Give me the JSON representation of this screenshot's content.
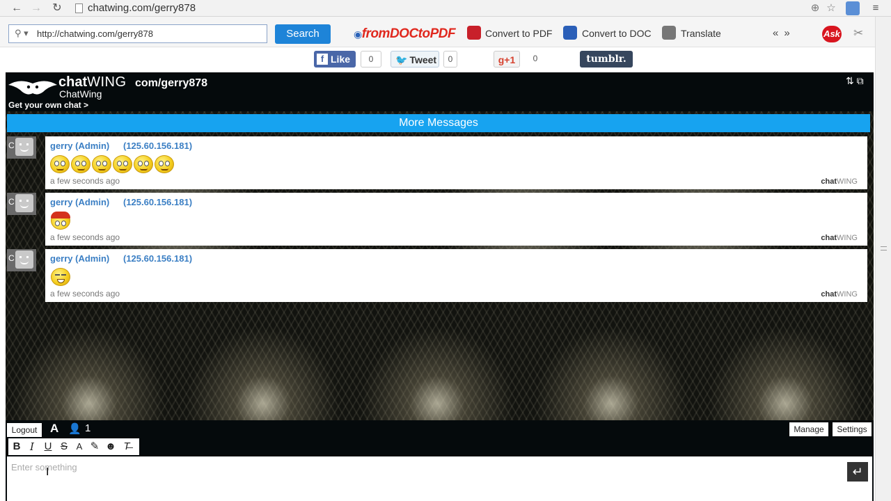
{
  "browser": {
    "url": "chatwing.com/gerry878",
    "back_icon": "←",
    "forward_icon": "→",
    "reload_icon": "↻",
    "zoom_icon": "⊕",
    "star_icon": "☆",
    "menu_icon": "≡"
  },
  "toolbar": {
    "search_value": "http://chatwing.com/gerry878",
    "search_button": "Search",
    "fromdoc_logo": "fromDOCtoPDF",
    "convert_pdf": "Convert to PDF",
    "convert_doc": "Convert to DOC",
    "translate": "Translate",
    "ask_logo": "Ask",
    "arrows": "«»"
  },
  "social": {
    "like_label": "Like",
    "like_count": "0",
    "tweet_label": "Tweet",
    "tweet_count": "0",
    "gplus_label": "g+1",
    "gplus_count": "0",
    "tumblr_label": "tumblr."
  },
  "chat": {
    "brand_bold": "chat",
    "brand_thin": "WING",
    "brand_url": "com/gerry878",
    "brand_sub": "ChatWing",
    "get_own_chat": "Get your own chat  >",
    "more_messages": "More Messages",
    "messages": [
      {
        "author": "gerry (Admin)",
        "ip": "(125.60.156.181)",
        "time": "a few seconds ago",
        "wm_bold": "chat",
        "wm_thin": "WING",
        "emoji_count": 6
      },
      {
        "author": "gerry (Admin)",
        "ip": "(125.60.156.181)",
        "time": "a few seconds ago",
        "wm_bold": "chat",
        "wm_thin": "WING",
        "emoji_count": 1
      },
      {
        "author": "gerry (Admin)",
        "ip": "(125.60.156.181)",
        "time": "a few seconds ago",
        "wm_bold": "chat",
        "wm_thin": "WING",
        "emoji_count": 1
      }
    ]
  },
  "composer": {
    "logout": "Logout",
    "font_icon": "A",
    "user_count": "1",
    "manage": "Manage",
    "settings": "Settings",
    "placeholder": "Enter something",
    "format": {
      "bold": "B",
      "italic": "I",
      "underline": "U",
      "strike": "S",
      "color": "A"
    }
  }
}
